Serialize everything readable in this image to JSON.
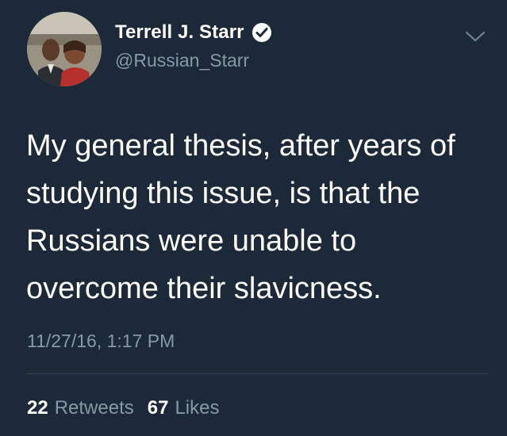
{
  "author": {
    "name": "Terrell J. Starr",
    "handle": "@Russian_Starr",
    "verified": true,
    "avatar_icon": "profile-photo"
  },
  "menu": {
    "icon": "chevron-down-icon"
  },
  "tweet": {
    "lines": [
      "My general thesis, after years of",
      "studying this issue, is that the",
      "Russians were unable to",
      "overcome their slavicness."
    ],
    "timestamp": "11/27/16, 1:17 PM"
  },
  "stats": {
    "retweets_count": "22",
    "retweets_label": "Retweets",
    "likes_count": "67",
    "likes_label": "Likes"
  },
  "colors": {
    "background": "#1c2938",
    "primary_text": "#ffffff",
    "secondary_text": "#8899a6",
    "divider": "#38444d"
  }
}
